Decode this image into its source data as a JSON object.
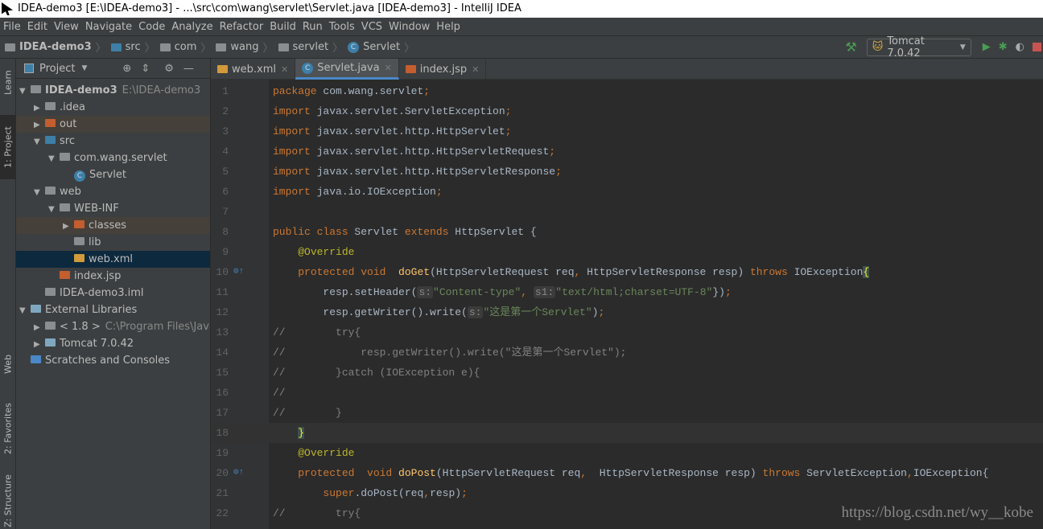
{
  "window": {
    "title": "IDEA-demo3 [E:\\IDEA-demo3] - ...\\src\\com\\wang\\servlet\\Servlet.java [IDEA-demo3] - IntelliJ IDEA"
  },
  "menu": [
    "File",
    "Edit",
    "View",
    "Navigate",
    "Code",
    "Analyze",
    "Refactor",
    "Build",
    "Run",
    "Tools",
    "VCS",
    "Window",
    "Help"
  ],
  "breadcrumb": [
    "IDEA-demo3",
    "src",
    "com",
    "wang",
    "servlet",
    "Servlet"
  ],
  "run": {
    "config": "Tomcat 7.0.42"
  },
  "left_strip": [
    "Learn",
    "1: Project",
    "Web",
    "2: Favorites",
    "Z: Structure"
  ],
  "project_panel": {
    "title": "Project"
  },
  "tree": [
    {
      "label": "IDEA-demo3",
      "extra": "E:\\IDEA-demo3",
      "depth": 0,
      "arrow": "down",
      "icon": "module",
      "bold": true
    },
    {
      "label": ".idea",
      "depth": 1,
      "arrow": "right",
      "icon": "folder"
    },
    {
      "label": "out",
      "depth": 1,
      "arrow": "right",
      "icon": "folder-excluded",
      "state": "excl"
    },
    {
      "label": "src",
      "depth": 1,
      "arrow": "down",
      "icon": "folder-source"
    },
    {
      "label": "com.wang.servlet",
      "depth": 2,
      "arrow": "down",
      "icon": "package"
    },
    {
      "label": "Servlet",
      "depth": 3,
      "icon": "class"
    },
    {
      "label": "web",
      "depth": 1,
      "arrow": "down",
      "icon": "folder-web"
    },
    {
      "label": "WEB-INF",
      "depth": 2,
      "arrow": "down",
      "icon": "folder"
    },
    {
      "label": "classes",
      "depth": 3,
      "arrow": "right",
      "icon": "folder-excluded",
      "state": "excl"
    },
    {
      "label": "lib",
      "depth": 3,
      "icon": "folder"
    },
    {
      "label": "web.xml",
      "depth": 3,
      "icon": "xml",
      "state": "sel"
    },
    {
      "label": "index.jsp",
      "depth": 2,
      "icon": "jsp"
    },
    {
      "label": "IDEA-demo3.iml",
      "depth": 1,
      "icon": "file"
    },
    {
      "label": "External Libraries",
      "depth": 0,
      "arrow": "down",
      "icon": "library"
    },
    {
      "label": "< 1.8 >",
      "extra": "C:\\Program Files\\Java\\j",
      "depth": 1,
      "arrow": "right",
      "icon": "jdk"
    },
    {
      "label": "Tomcat 7.0.42",
      "depth": 1,
      "arrow": "right",
      "icon": "library"
    },
    {
      "label": "Scratches and Consoles",
      "depth": 0,
      "icon": "scratch"
    }
  ],
  "tabs": [
    {
      "label": "web.xml",
      "icon": "xml"
    },
    {
      "label": "Servlet.java",
      "icon": "class",
      "active": true
    },
    {
      "label": "index.jsp",
      "icon": "jsp"
    }
  ],
  "code": [
    [
      [
        "kw",
        "package "
      ],
      [
        "",
        "com.wang.servlet"
      ],
      [
        "kw",
        ";"
      ]
    ],
    [
      [
        "kw",
        "import "
      ],
      [
        "",
        "javax.servlet.ServletException"
      ],
      [
        "kw",
        ";"
      ]
    ],
    [
      [
        "kw",
        "import "
      ],
      [
        "",
        "javax.servlet.http.HttpServlet"
      ],
      [
        "kw",
        ";"
      ]
    ],
    [
      [
        "kw",
        "import "
      ],
      [
        "",
        "javax.servlet.http.HttpServletRequest"
      ],
      [
        "kw",
        ";"
      ]
    ],
    [
      [
        "kw",
        "import "
      ],
      [
        "",
        "javax.servlet.http.HttpServletResponse"
      ],
      [
        "kw",
        ";"
      ]
    ],
    [
      [
        "kw",
        "import "
      ],
      [
        "",
        "java.io.IOException"
      ],
      [
        "kw",
        ";"
      ]
    ],
    [],
    [
      [
        "kw",
        "public class "
      ],
      [
        "",
        "Servlet "
      ],
      [
        "kw",
        "extends "
      ],
      [
        "",
        "HttpServlet {"
      ]
    ],
    [
      [
        "",
        "    "
      ],
      [
        "ann",
        "@Override"
      ]
    ],
    [
      [
        "",
        "    "
      ],
      [
        "kw",
        "protected void  "
      ],
      [
        "fn",
        "doGet"
      ],
      [
        "",
        "(HttpServletRequest req"
      ],
      [
        "kw",
        ", "
      ],
      [
        "",
        "HttpServletResponse resp) "
      ],
      [
        "kw",
        "throws "
      ],
      [
        "",
        "IOException"
      ],
      [
        "brace",
        "{"
      ]
    ],
    [
      [
        "",
        "        resp.setHeader("
      ],
      [
        "hint",
        "s:"
      ],
      [
        "str",
        "\"Content-type\""
      ],
      [
        "kw",
        ", "
      ],
      [
        "hint",
        "s1:"
      ],
      [
        "str",
        "\"text/html;charset=UTF-8\""
      ],
      [
        "",
        "})"
      ],
      [
        "kw",
        ";"
      ]
    ],
    [
      [
        "",
        "        resp.getWriter().write("
      ],
      [
        "hint",
        "s:"
      ],
      [
        "str",
        "\"这是第一个Servlet\""
      ],
      [
        "",
        ")"
      ],
      [
        "kw",
        ";"
      ]
    ],
    [
      [
        "cm",
        "//        try{"
      ]
    ],
    [
      [
        "cm",
        "//            resp.getWriter().write(\"这是第一个Servlet\");"
      ]
    ],
    [
      [
        "cm",
        "//        }catch (IOException e){"
      ]
    ],
    [
      [
        "cm",
        "//"
      ]
    ],
    [
      [
        "cm",
        "//        }"
      ]
    ],
    [
      [
        "",
        "    "
      ],
      [
        "brace",
        "}"
      ]
    ],
    [
      [
        "",
        "    "
      ],
      [
        "ann",
        "@Override"
      ]
    ],
    [
      [
        "",
        "    "
      ],
      [
        "kw",
        "protected  void "
      ],
      [
        "fn",
        "doPost"
      ],
      [
        "",
        "(HttpServletRequest req"
      ],
      [
        "kw",
        ",  "
      ],
      [
        "",
        "HttpServletResponse resp) "
      ],
      [
        "kw",
        "throws "
      ],
      [
        "",
        "ServletException"
      ],
      [
        "kw",
        ","
      ],
      [
        "",
        "IOException{"
      ]
    ],
    [
      [
        "",
        "        "
      ],
      [
        "kw",
        "super"
      ],
      [
        "",
        ".doPost(req"
      ],
      [
        "kw",
        ","
      ],
      [
        "",
        "resp)"
      ],
      [
        "kw",
        ";"
      ]
    ],
    [
      [
        "cm",
        "//        try{"
      ]
    ]
  ],
  "current_line": 18,
  "watermark": "https://blog.csdn.net/wy__kobe",
  "colors": {
    "keyword": "#cc7832",
    "string": "#6a8759",
    "annotation": "#bbb529",
    "method": "#ffc66d",
    "comment": "#808080",
    "accent": "#4a88c7"
  }
}
